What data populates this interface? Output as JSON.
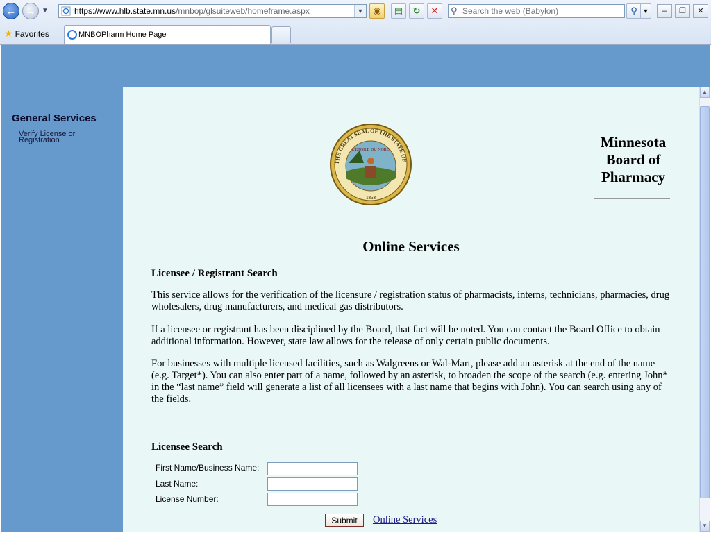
{
  "browser": {
    "url_prefix": "https://www.",
    "url_host": "hlb.state.mn.us",
    "url_path": "/mnbop/glsuiteweb/homeframe.aspx",
    "search_placeholder": "Search the web (Babylon)",
    "favorites_label": "Favorites",
    "tab_title": "MNBOPharm Home Page",
    "icons": [
      "back-icon",
      "forward-icon",
      "lock-icon",
      "compatibility-icon",
      "refresh-icon",
      "stop-icon",
      "search-icon",
      "star-icon",
      "ie-icon"
    ]
  },
  "sidebar": {
    "title": "General Services",
    "link_line1": "Verify License or",
    "link_line2": "Registration"
  },
  "header": {
    "board_line1": "Minnesota",
    "board_line2": "Board of",
    "board_line3": "Pharmacy",
    "seal_text_top": "THE GREAT SEAL OF THE STATE OF MINNESOTA",
    "seal_motto": "L'ETOILE DU NORD",
    "seal_year": "1858"
  },
  "main": {
    "title": "Online Services",
    "section_heading": "Licensee / Registrant Search",
    "paragraph1": "This service allows for the verification of the licensure / registration status of pharmacists, interns, technicians, pharmacies, drug wholesalers, drug manufacturers, and medical gas distributors.",
    "paragraph2": "If a licensee or registrant has been disciplined by the Board, that fact will be noted. You can contact the Board Office to obtain additional information. However, state law allows for the release of only certain public documents.",
    "paragraph3": "For businesses with multiple licensed facilities, such as Walgreens or Wal-Mart, please add an asterisk at the end of the name (e.g. Target*). You can also enter part of a name, followed by an asterisk, to broaden the scope of the search (e.g. entering John* in the “last name” field will generate a list of all licensees with a last name that begins with John). You can search using any of the fields.",
    "search_heading": "Licensee Search"
  },
  "form": {
    "first_name_label": "First Name/Business Name:",
    "last_name_label": "Last Name:",
    "license_number_label": "License Number:",
    "first_name_value": "",
    "last_name_value": "",
    "license_number_value": "",
    "submit_label": "Submit",
    "online_services_link": "Online Services"
  },
  "colors": {
    "outer_background": "#6699cc",
    "content_background": "#e9f8f6"
  }
}
